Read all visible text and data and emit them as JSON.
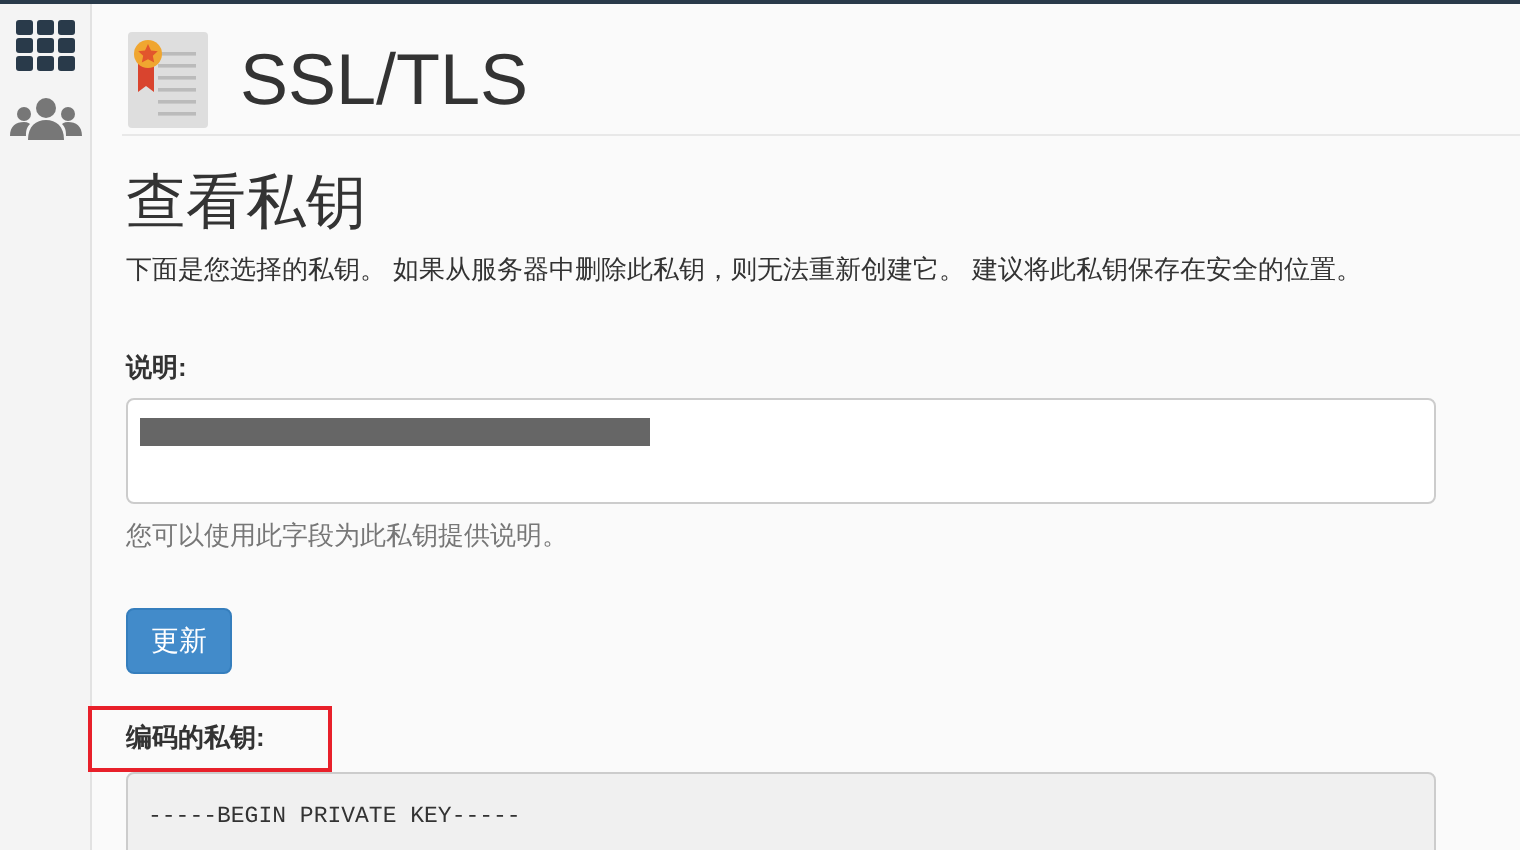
{
  "header": {
    "title": "SSL/TLS"
  },
  "page": {
    "heading": "查看私钥",
    "intro": "下面是您选择的私钥。 如果从服务器中删除此私钥，则无法重新创建它。 建议将此私钥保存在安全的位置。"
  },
  "description_field": {
    "label": "说明:",
    "help": "您可以使用此字段为此私钥提供说明。"
  },
  "update_button": "更新",
  "encoded_key": {
    "label": "编码的私钥:",
    "highlighted": true,
    "first_line": "-----BEGIN PRIVATE KEY-----"
  }
}
